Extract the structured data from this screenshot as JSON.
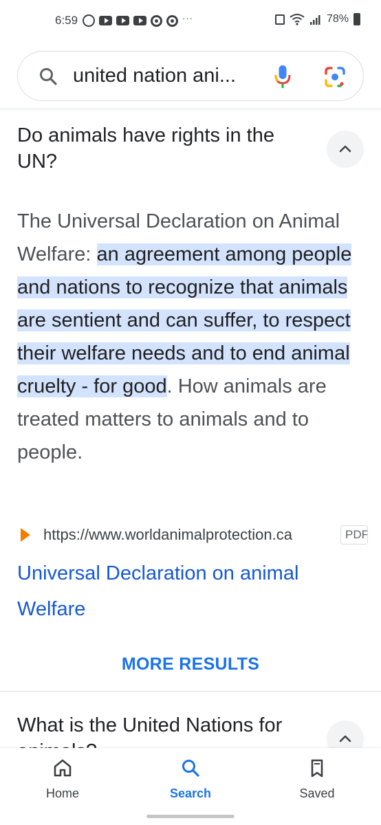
{
  "status_bar": {
    "time": "6:59",
    "battery": "78%",
    "more": "···"
  },
  "search": {
    "query": "united nation ani..."
  },
  "faq": {
    "question": "Do animals have rights in the UN?",
    "answer_lead": "The Universal Declaration on Animal Welfare: ",
    "answer_highlight": "an agreement among people and nations to recognize that animals are sentient and can suffer, to respect their welfare needs and to end animal cruelty - for good",
    "answer_tail": ". How animals are treated matters to animals and to people.",
    "source_url": "https://www.worldanimalprotection.ca",
    "source_badge": "PDF",
    "result_title": "Universal Declaration on animal Welfare",
    "more_results": "MORE RESULTS",
    "next_question": "What is the United Nations for animals?"
  },
  "bottom_nav": {
    "items": [
      {
        "label": "Home",
        "icon": "home-icon"
      },
      {
        "label": "Search",
        "icon": "search-icon"
      },
      {
        "label": "Saved",
        "icon": "bookmarks-icon"
      }
    ],
    "active": "Search"
  },
  "colors": {
    "link": "#1558d6",
    "accent": "#1a73e8",
    "highlight": "#d3e3fd",
    "source_arrow": "#f57c00"
  }
}
